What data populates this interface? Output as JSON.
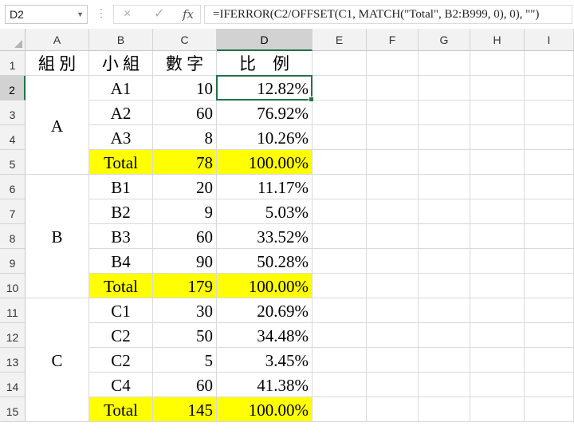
{
  "name_box": "D2",
  "formula": "=IFERROR(C2/OFFSET(C1, MATCH(\"Total\", B2:B999, 0), 0), \"\")",
  "icons": {
    "dropdown": "chevron-down-icon",
    "cancel": "×",
    "enter": "✓",
    "fx": "fx"
  },
  "columns": [
    "A",
    "B",
    "C",
    "D",
    "E",
    "F",
    "G",
    "H",
    "I"
  ],
  "rows": [
    "1",
    "2",
    "3",
    "4",
    "5",
    "6",
    "7",
    "8",
    "9",
    "10",
    "11",
    "12",
    "13",
    "14",
    "15"
  ],
  "selected_cell": "D2",
  "highlight_color": "#ffff00",
  "headers": {
    "group": "組 別",
    "subgroup": "小 組",
    "number": "數 字",
    "ratio": "比　例"
  },
  "groups": [
    {
      "label": "A",
      "items": [
        {
          "sub": "A1",
          "num": "10",
          "ratio": "12.82%"
        },
        {
          "sub": "A2",
          "num": "60",
          "ratio": "76.92%"
        },
        {
          "sub": "A3",
          "num": "8",
          "ratio": "10.26%"
        }
      ],
      "total": {
        "label": "Total",
        "num": "78",
        "ratio": "100.00%"
      }
    },
    {
      "label": "B",
      "items": [
        {
          "sub": "B1",
          "num": "20",
          "ratio": "11.17%"
        },
        {
          "sub": "B2",
          "num": "9",
          "ratio": "5.03%"
        },
        {
          "sub": "B3",
          "num": "60",
          "ratio": "33.52%"
        },
        {
          "sub": "B4",
          "num": "90",
          "ratio": "50.28%"
        }
      ],
      "total": {
        "label": "Total",
        "num": "179",
        "ratio": "100.00%"
      }
    },
    {
      "label": "C",
      "items": [
        {
          "sub": "C1",
          "num": "30",
          "ratio": "20.69%"
        },
        {
          "sub": "C2",
          "num": "50",
          "ratio": "34.48%"
        },
        {
          "sub": "C2",
          "num": "5",
          "ratio": "3.45%"
        },
        {
          "sub": "C4",
          "num": "60",
          "ratio": "41.38%"
        }
      ],
      "total": {
        "label": "Total",
        "num": "145",
        "ratio": "100.00%"
      }
    }
  ]
}
